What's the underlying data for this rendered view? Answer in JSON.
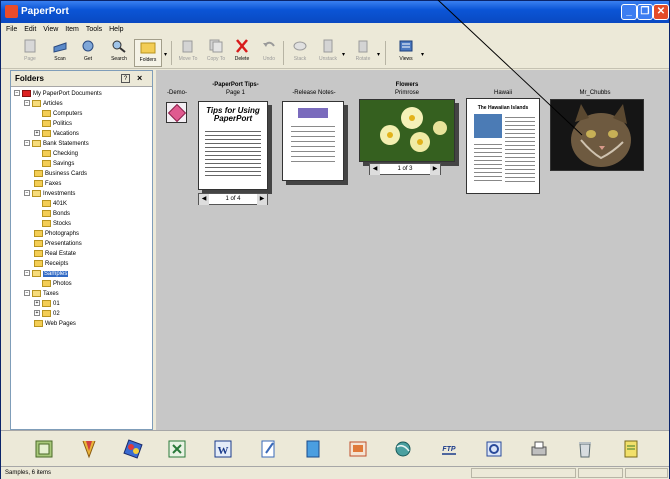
{
  "window": {
    "title": "PaperPort"
  },
  "menu": [
    "File",
    "Edit",
    "View",
    "Item",
    "Tools",
    "Help"
  ],
  "toolbar": {
    "page": "Page",
    "scan": "Scan",
    "get": "Get",
    "search": "Search",
    "folders": "Folders",
    "move_to": "Move To",
    "copy_to": "Copy To",
    "delete": "Delete",
    "undo": "Undo",
    "stack": "Stack",
    "unstack": "Unstack",
    "rotate": "Rotate",
    "views": "Views"
  },
  "folders_panel": {
    "title": "Folders",
    "help": "?",
    "close": "×"
  },
  "tree": [
    "My PaperPort Documents",
    "Articles",
    "Computers",
    "Politics",
    "Vacations",
    "Bank Statements",
    "Checking",
    "Savings",
    "Business Cards",
    "Faxes",
    "Investments",
    "401K",
    "Bonds",
    "Stocks",
    "Photographs",
    "Presentations",
    "Real Estate",
    "Receipts",
    "Samples",
    "Photos",
    "Taxes",
    "01",
    "02",
    "Web Pages"
  ],
  "items": {
    "demo": "-Demo-",
    "tips_title": "-PaperPort Tips-",
    "tips_page": "Page 1",
    "tips_doc": "Tips for Using PaperPort",
    "tips_pager": "1 of 4",
    "release": "-Release Notes-",
    "flowers_title": "Flowers",
    "flowers_sub": "Primrose",
    "flowers_pager": "1 of 3",
    "hawaii": "Hawaii",
    "hawaii_doc": "The Hawaiian Islands",
    "chubbs": "Mr_Chubbs"
  },
  "status": {
    "text": "Samples, 6 items"
  },
  "colors": {
    "titlebar": "#0b55d6",
    "workspace": "#c7c7c7",
    "selection": "#316ac5"
  }
}
